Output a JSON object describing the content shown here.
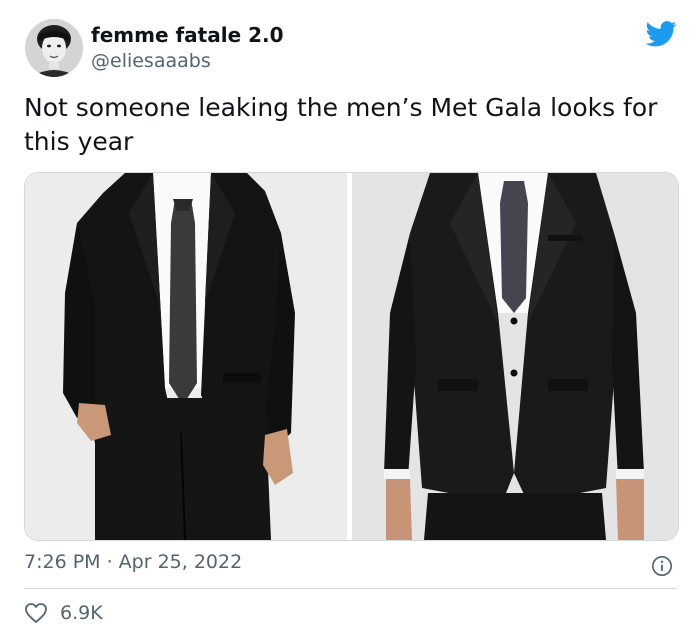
{
  "user": {
    "display_name": "femme fatale 2.0",
    "handle": "@eliesaaabs"
  },
  "tweet": {
    "text": "Not someone leaking the men’s Met Gala looks for this year",
    "timestamp": "7:26 PM · Apr 25, 2022"
  },
  "engagement": {
    "likes": "6.9K"
  },
  "media": [
    {
      "description": "black suit, white shirt, dark dotted tie, hand in pocket"
    },
    {
      "description": "black suit, white shirt, dark dotted tie, front view"
    }
  ],
  "icons": {
    "logo": "twitter-bird-icon",
    "info": "info-icon",
    "like": "heart-icon"
  },
  "colors": {
    "brand": "#1d9bf0",
    "text": "#0f1419",
    "secondary": "#536471",
    "border": "#cfd9de"
  }
}
